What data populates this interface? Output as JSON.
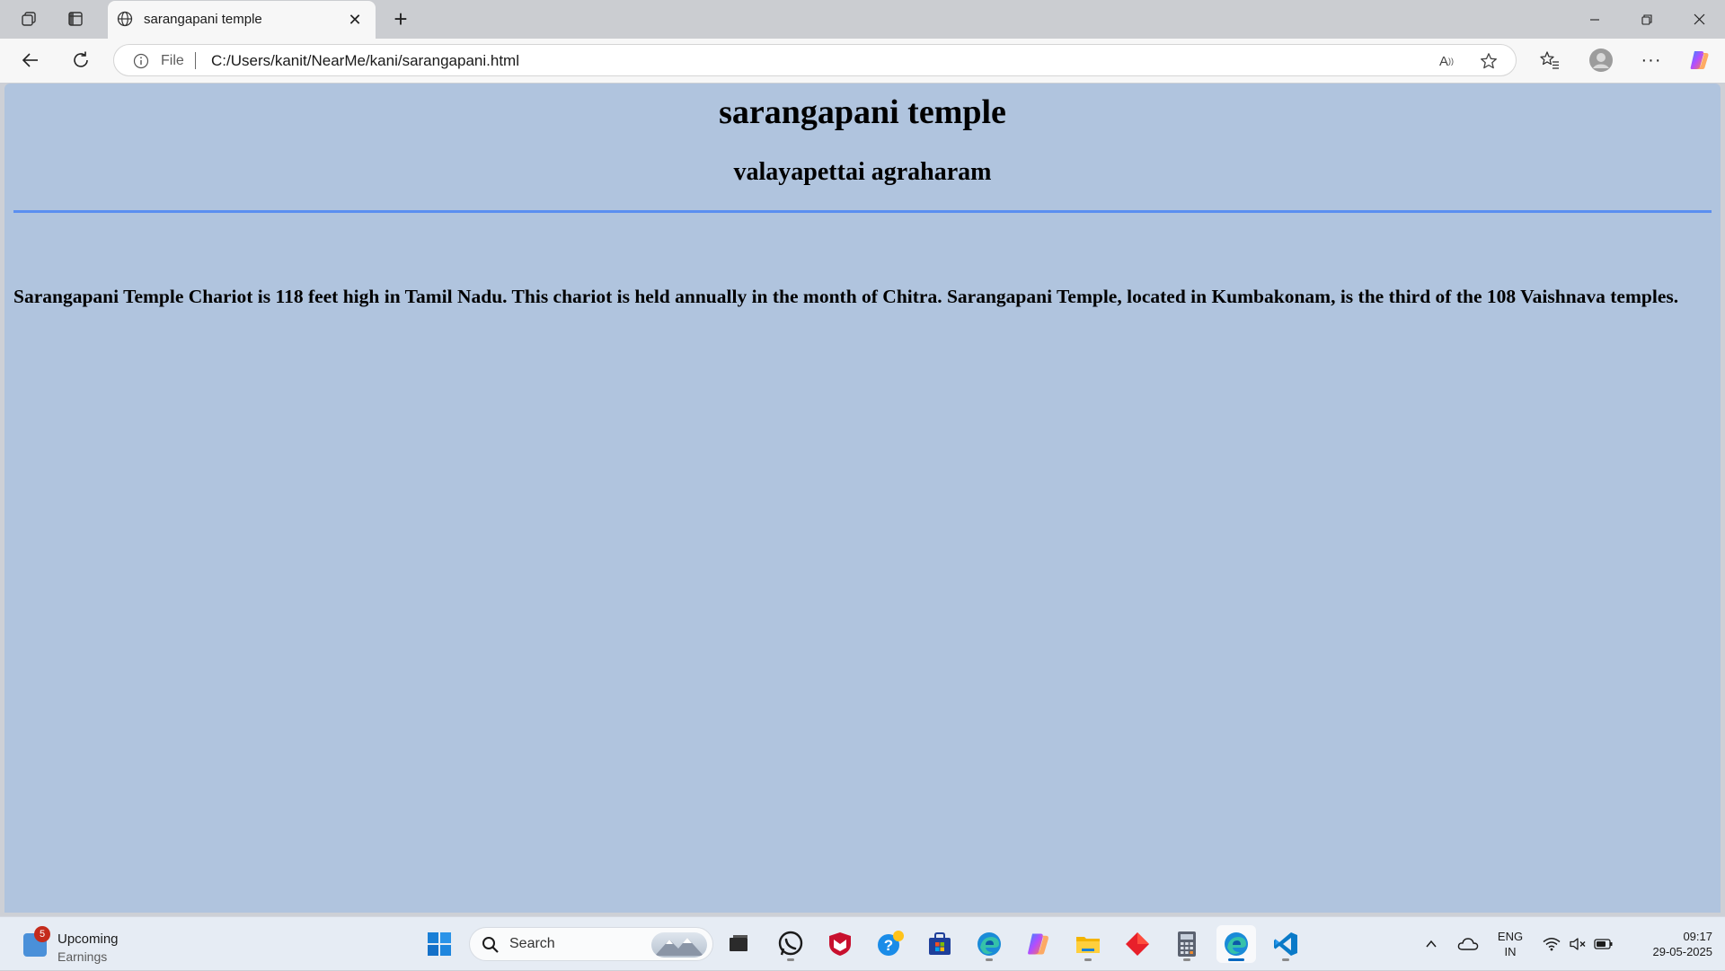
{
  "browser": {
    "tab_title": "sarangapani temple",
    "address": {
      "scheme_label": "File",
      "url": "C:/Users/kanit/NearMe/kani/sarangapani.html"
    }
  },
  "page": {
    "background_color": "#b0c4de",
    "rule_color": "#5b8ff0",
    "heading": "sarangapani temple",
    "subheading": "valayapettai agraharam",
    "paragraph": "Sarangapani Temple Chariot is 118 feet high in Tamil Nadu. This chariot is held annually in the month of Chitra. Sarangapani Temple, located in Kumbakonam, is the third of the 108 Vaishnava temples."
  },
  "taskbar": {
    "widget": {
      "badge": "5",
      "title": "Upcoming",
      "subtitle": "Earnings"
    },
    "search_placeholder": "Search",
    "pinned_apps": [
      "windows-start-icon",
      "task-view-icon",
      "whatsapp-icon",
      "mcafee-icon",
      "get-help-icon",
      "microsoft-store-icon",
      "edge-icon",
      "copilot-icon",
      "file-explorer-icon",
      "red-diamond-app-icon",
      "calculator-icon",
      "edge-active-icon",
      "vscode-icon"
    ],
    "tray": {
      "language_line1": "ENG",
      "language_line2": "IN",
      "time": "09:17",
      "date": "29-05-2025"
    }
  }
}
